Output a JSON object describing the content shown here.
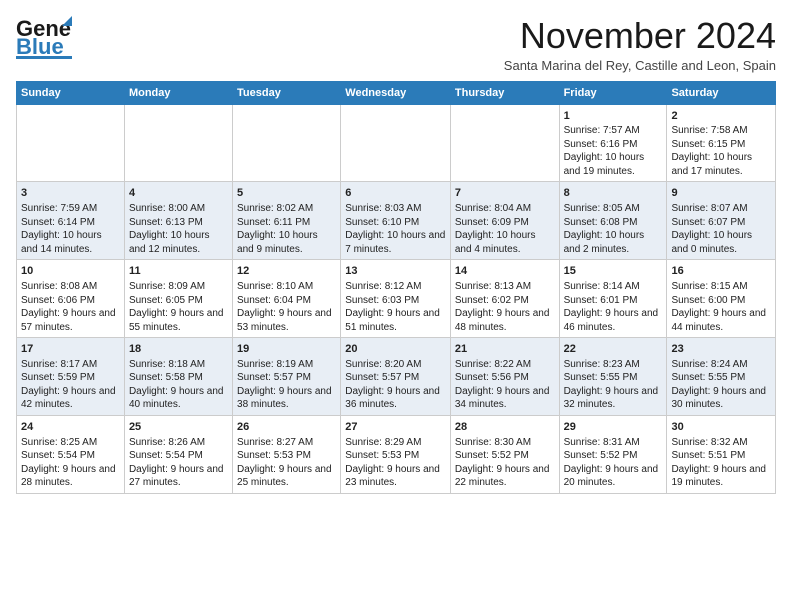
{
  "header": {
    "logo_line1": "General",
    "logo_line2": "Blue",
    "month": "November 2024",
    "location": "Santa Marina del Rey, Castille and Leon, Spain"
  },
  "weekdays": [
    "Sunday",
    "Monday",
    "Tuesday",
    "Wednesday",
    "Thursday",
    "Friday",
    "Saturday"
  ],
  "weeks": [
    [
      {
        "day": "",
        "info": ""
      },
      {
        "day": "",
        "info": ""
      },
      {
        "day": "",
        "info": ""
      },
      {
        "day": "",
        "info": ""
      },
      {
        "day": "",
        "info": ""
      },
      {
        "day": "1",
        "info": "Sunrise: 7:57 AM\nSunset: 6:16 PM\nDaylight: 10 hours and 19 minutes."
      },
      {
        "day": "2",
        "info": "Sunrise: 7:58 AM\nSunset: 6:15 PM\nDaylight: 10 hours and 17 minutes."
      }
    ],
    [
      {
        "day": "3",
        "info": "Sunrise: 7:59 AM\nSunset: 6:14 PM\nDaylight: 10 hours and 14 minutes."
      },
      {
        "day": "4",
        "info": "Sunrise: 8:00 AM\nSunset: 6:13 PM\nDaylight: 10 hours and 12 minutes."
      },
      {
        "day": "5",
        "info": "Sunrise: 8:02 AM\nSunset: 6:11 PM\nDaylight: 10 hours and 9 minutes."
      },
      {
        "day": "6",
        "info": "Sunrise: 8:03 AM\nSunset: 6:10 PM\nDaylight: 10 hours and 7 minutes."
      },
      {
        "day": "7",
        "info": "Sunrise: 8:04 AM\nSunset: 6:09 PM\nDaylight: 10 hours and 4 minutes."
      },
      {
        "day": "8",
        "info": "Sunrise: 8:05 AM\nSunset: 6:08 PM\nDaylight: 10 hours and 2 minutes."
      },
      {
        "day": "9",
        "info": "Sunrise: 8:07 AM\nSunset: 6:07 PM\nDaylight: 10 hours and 0 minutes."
      }
    ],
    [
      {
        "day": "10",
        "info": "Sunrise: 8:08 AM\nSunset: 6:06 PM\nDaylight: 9 hours and 57 minutes."
      },
      {
        "day": "11",
        "info": "Sunrise: 8:09 AM\nSunset: 6:05 PM\nDaylight: 9 hours and 55 minutes."
      },
      {
        "day": "12",
        "info": "Sunrise: 8:10 AM\nSunset: 6:04 PM\nDaylight: 9 hours and 53 minutes."
      },
      {
        "day": "13",
        "info": "Sunrise: 8:12 AM\nSunset: 6:03 PM\nDaylight: 9 hours and 51 minutes."
      },
      {
        "day": "14",
        "info": "Sunrise: 8:13 AM\nSunset: 6:02 PM\nDaylight: 9 hours and 48 minutes."
      },
      {
        "day": "15",
        "info": "Sunrise: 8:14 AM\nSunset: 6:01 PM\nDaylight: 9 hours and 46 minutes."
      },
      {
        "day": "16",
        "info": "Sunrise: 8:15 AM\nSunset: 6:00 PM\nDaylight: 9 hours and 44 minutes."
      }
    ],
    [
      {
        "day": "17",
        "info": "Sunrise: 8:17 AM\nSunset: 5:59 PM\nDaylight: 9 hours and 42 minutes."
      },
      {
        "day": "18",
        "info": "Sunrise: 8:18 AM\nSunset: 5:58 PM\nDaylight: 9 hours and 40 minutes."
      },
      {
        "day": "19",
        "info": "Sunrise: 8:19 AM\nSunset: 5:57 PM\nDaylight: 9 hours and 38 minutes."
      },
      {
        "day": "20",
        "info": "Sunrise: 8:20 AM\nSunset: 5:57 PM\nDaylight: 9 hours and 36 minutes."
      },
      {
        "day": "21",
        "info": "Sunrise: 8:22 AM\nSunset: 5:56 PM\nDaylight: 9 hours and 34 minutes."
      },
      {
        "day": "22",
        "info": "Sunrise: 8:23 AM\nSunset: 5:55 PM\nDaylight: 9 hours and 32 minutes."
      },
      {
        "day": "23",
        "info": "Sunrise: 8:24 AM\nSunset: 5:55 PM\nDaylight: 9 hours and 30 minutes."
      }
    ],
    [
      {
        "day": "24",
        "info": "Sunrise: 8:25 AM\nSunset: 5:54 PM\nDaylight: 9 hours and 28 minutes."
      },
      {
        "day": "25",
        "info": "Sunrise: 8:26 AM\nSunset: 5:54 PM\nDaylight: 9 hours and 27 minutes."
      },
      {
        "day": "26",
        "info": "Sunrise: 8:27 AM\nSunset: 5:53 PM\nDaylight: 9 hours and 25 minutes."
      },
      {
        "day": "27",
        "info": "Sunrise: 8:29 AM\nSunset: 5:53 PM\nDaylight: 9 hours and 23 minutes."
      },
      {
        "day": "28",
        "info": "Sunrise: 8:30 AM\nSunset: 5:52 PM\nDaylight: 9 hours and 22 minutes."
      },
      {
        "day": "29",
        "info": "Sunrise: 8:31 AM\nSunset: 5:52 PM\nDaylight: 9 hours and 20 minutes."
      },
      {
        "day": "30",
        "info": "Sunrise: 8:32 AM\nSunset: 5:51 PM\nDaylight: 9 hours and 19 minutes."
      }
    ]
  ]
}
